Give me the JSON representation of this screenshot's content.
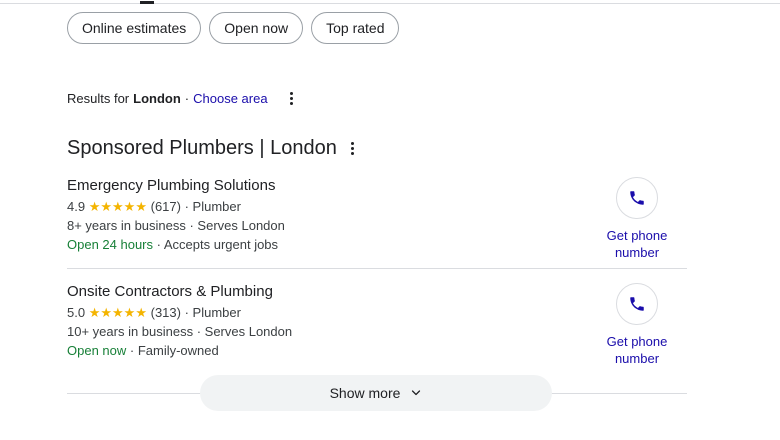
{
  "filters": [
    "Online estimates",
    "Open now",
    "Top rated"
  ],
  "location_bar": {
    "prefix": "Results for",
    "location": "London",
    "separator": "·",
    "choose_area": "Choose area"
  },
  "section": {
    "title": "Sponsored Plumbers | London"
  },
  "listings": [
    {
      "name": "Emergency Plumbing Solutions",
      "rating": "4.9",
      "stars": "★★★★★",
      "reviews": "(617)",
      "category": "· Plumber",
      "experience": "8+ years in business · Serves London",
      "status": "Open 24 hours",
      "status_note": "· Accepts urgent jobs",
      "call_label_1": "Get phone",
      "call_label_2": "number"
    },
    {
      "name": "Onsite Contractors & Plumbing",
      "rating": "5.0",
      "stars": "★★★★★",
      "reviews": "(313)",
      "category": "· Plumber",
      "experience": "10+ years in business · Serves London",
      "status": "Open now",
      "status_note": "· Family-owned",
      "call_label_1": "Get phone",
      "call_label_2": "number"
    }
  ],
  "show_more": {
    "label": "Show more"
  },
  "icons": {
    "phone": "phone-icon",
    "more": "more-vert-icon",
    "chevron": "chevron-down-icon",
    "star": "star-icon"
  },
  "colors": {
    "link": "#1a0dab",
    "open_status": "#188038",
    "star": "#f4b400",
    "phone_icon": "#1a0dab"
  }
}
